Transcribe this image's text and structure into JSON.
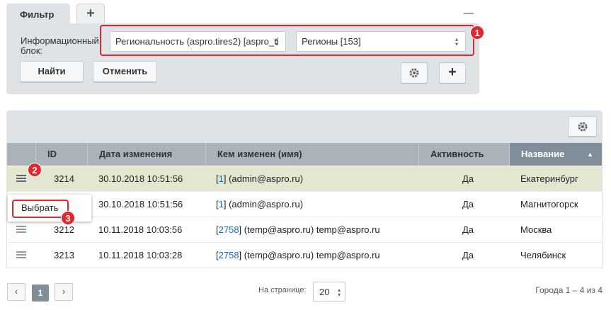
{
  "filter": {
    "tab_label": "Фильтр",
    "tab_add_glyph": "+",
    "iblock_label": "Информационный блок:",
    "iblock_value": "Региональность (aspro.tires2) [aspro_ti",
    "section_value": "Регионы [153]",
    "find_label": "Найти",
    "cancel_label": "Отменить",
    "add_glyph": "+"
  },
  "annotations": {
    "badge1": "1",
    "badge2": "2",
    "badge3": "3"
  },
  "grid": {
    "columns": [
      "ID",
      "Дата изменения",
      "Кем изменен (имя)",
      "Активность",
      "Название"
    ],
    "sort_glyph": "▲",
    "rows": [
      {
        "id": "3214",
        "date": "30.10.2018 10:51:56",
        "user_id": "1",
        "user_rest": " (admin@aspro.ru)",
        "active": "Да",
        "name": "Екатеринбург"
      },
      {
        "id": "",
        "date": "30.10.2018 10:51:56",
        "user_id": "1",
        "user_rest": " (admin@aspro.ru)",
        "active": "Да",
        "name": "Магнитогорск"
      },
      {
        "id": "3212",
        "date": "10.11.2018 10:03:56",
        "user_id": "2758",
        "user_rest": " (temp@aspro.ru) temp@aspro.ru",
        "active": "Да",
        "name": "Москва"
      },
      {
        "id": "3213",
        "date": "10.11.2018 10:03:28",
        "user_id": "2758",
        "user_rest": " (temp@aspro.ru) temp@aspro.ru",
        "active": "Да",
        "name": "Челябинск"
      }
    ],
    "context_menu_item": "Выбрать"
  },
  "footer": {
    "current_page": "1",
    "prev_glyph": "‹",
    "next_glyph": "›",
    "per_page_label": "На странице:",
    "per_page_value": "20",
    "totals": "Города 1 – 4 из 4"
  },
  "colors": {
    "accent_red": "#e3262b",
    "panel": "#dde3e6",
    "sorted_header": "#7f8e99",
    "link": "#2067b0"
  },
  "icons": [
    "plus-icon",
    "minimize-icon",
    "gear-icon",
    "hamburger-menu-icon",
    "sort-asc-icon",
    "chevron-left-icon",
    "chevron-right-icon",
    "select-arrows-icon"
  ]
}
